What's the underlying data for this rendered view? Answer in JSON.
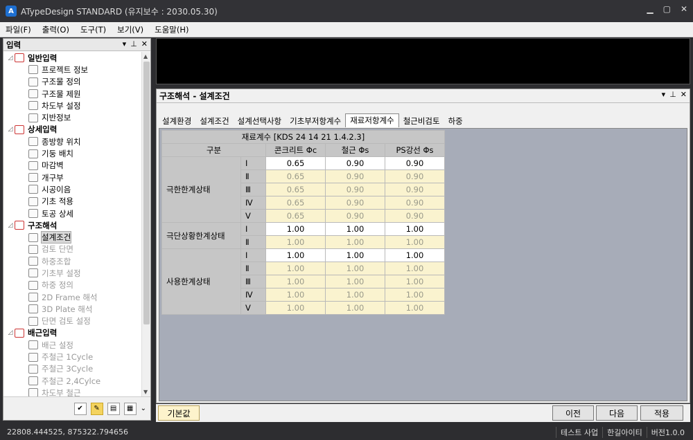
{
  "window": {
    "title": "ATypeDesign STANDARD  (유지보수 : 2030.05.30)",
    "app_icon": "app-logo-icon"
  },
  "menu": [
    "파일(F)",
    "출력(O)",
    "도구(T)",
    "보기(V)",
    "도움말(H)"
  ],
  "left_pane": {
    "title": "입력",
    "tree": [
      {
        "label": "일반입력",
        "group": true,
        "exp": "◿"
      },
      {
        "label": "프로젝트 정보"
      },
      {
        "label": "구조물 정의"
      },
      {
        "label": "구조물 제원"
      },
      {
        "label": "차도부 설정"
      },
      {
        "label": "지반정보"
      },
      {
        "label": "상세입력",
        "group": true,
        "exp": "◿"
      },
      {
        "label": "종방향 위치"
      },
      {
        "label": "기둥 배치"
      },
      {
        "label": "마감벽"
      },
      {
        "label": "개구부"
      },
      {
        "label": "시공이음"
      },
      {
        "label": "기초 적용"
      },
      {
        "label": "토공 상세"
      },
      {
        "label": "구조해석",
        "group": true,
        "exp": "◿"
      },
      {
        "label": "설계조건",
        "selected": true
      },
      {
        "label": "검토 단면",
        "disabled": true
      },
      {
        "label": "하중조합",
        "disabled": true
      },
      {
        "label": "기초부 설정",
        "disabled": true
      },
      {
        "label": "하중 정의",
        "disabled": true
      },
      {
        "label": "2D Frame 해석",
        "disabled": true
      },
      {
        "label": "3D Plate 해석",
        "disabled": true
      },
      {
        "label": "단면 검토 설정",
        "disabled": true
      },
      {
        "label": "배근입력",
        "group": true,
        "exp": "◿"
      },
      {
        "label": "배근 설정",
        "disabled": true
      },
      {
        "label": "주철근 1Cycle",
        "disabled": true
      },
      {
        "label": "주철근 3Cycle",
        "disabled": true
      },
      {
        "label": "주철근 2,4Cylce",
        "disabled": true
      },
      {
        "label": "차도부 철근",
        "disabled": true
      }
    ]
  },
  "main_pane": {
    "title": "구조해석 - 설계조건",
    "tabs": [
      "설계환경",
      "설계조건",
      "설계선택사항",
      "기초부저항계수",
      "재료저항계수",
      "철근비검토",
      "하중"
    ],
    "active_tab": 4,
    "table": {
      "caption": "재료계수 [KDS 24 14 21 1.4.2.3]",
      "headers": [
        "구분",
        "콘크리트 Φc",
        "철근 Φs",
        "PS강선 Φs"
      ],
      "groups": [
        {
          "name": "극한한계상태",
          "rows": [
            {
              "n": "Ⅰ",
              "v": [
                "0.65",
                "0.90",
                "0.90"
              ],
              "editable": true
            },
            {
              "n": "Ⅱ",
              "v": [
                "0.65",
                "0.90",
                "0.90"
              ]
            },
            {
              "n": "Ⅲ",
              "v": [
                "0.65",
                "0.90",
                "0.90"
              ]
            },
            {
              "n": "Ⅳ",
              "v": [
                "0.65",
                "0.90",
                "0.90"
              ]
            },
            {
              "n": "Ⅴ",
              "v": [
                "0.65",
                "0.90",
                "0.90"
              ]
            }
          ]
        },
        {
          "name": "극단상황한계상태",
          "rows": [
            {
              "n": "Ⅰ",
              "v": [
                "1.00",
                "1.00",
                "1.00"
              ],
              "editable": true
            },
            {
              "n": "Ⅱ",
              "v": [
                "1.00",
                "1.00",
                "1.00"
              ]
            }
          ]
        },
        {
          "name": "사용한계상태",
          "rows": [
            {
              "n": "Ⅰ",
              "v": [
                "1.00",
                "1.00",
                "1.00"
              ],
              "editable": true
            },
            {
              "n": "Ⅱ",
              "v": [
                "1.00",
                "1.00",
                "1.00"
              ]
            },
            {
              "n": "Ⅲ",
              "v": [
                "1.00",
                "1.00",
                "1.00"
              ]
            },
            {
              "n": "Ⅳ",
              "v": [
                "1.00",
                "1.00",
                "1.00"
              ]
            },
            {
              "n": "Ⅴ",
              "v": [
                "1.00",
                "1.00",
                "1.00"
              ]
            }
          ]
        }
      ]
    }
  },
  "buttons": {
    "default": "기본값",
    "prev": "이전",
    "next": "다음",
    "apply": "적용"
  },
  "status": {
    "coords": "22808.444525,  875322.794656",
    "company": "테스트 사업",
    "user": "한길아이티",
    "version": "버전1.0.0"
  }
}
